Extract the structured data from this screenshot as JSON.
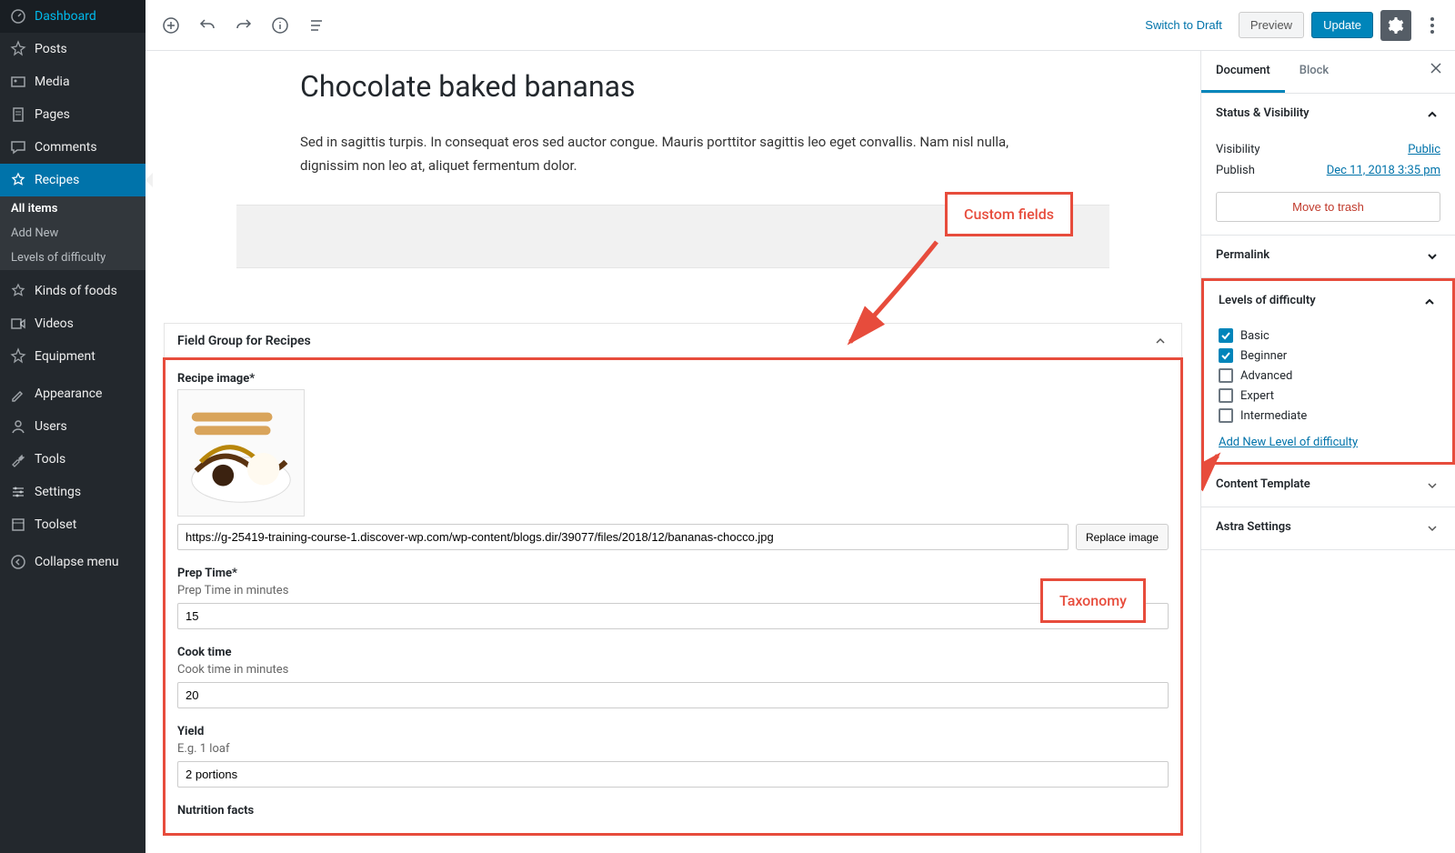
{
  "sidebar": {
    "items": [
      {
        "label": "Dashboard",
        "icon": "dashboard"
      },
      {
        "label": "Posts",
        "icon": "pin"
      },
      {
        "label": "Media",
        "icon": "media"
      },
      {
        "label": "Pages",
        "icon": "page"
      },
      {
        "label": "Comments",
        "icon": "comment"
      },
      {
        "label": "Recipes",
        "icon": "star",
        "active": true,
        "sub": [
          {
            "label": "All items",
            "current": true
          },
          {
            "label": "Add New"
          },
          {
            "label": "Levels of difficulty"
          }
        ]
      },
      {
        "label": "Kinds of foods",
        "icon": "star"
      },
      {
        "label": "Videos",
        "icon": "video"
      },
      {
        "label": "Equipment",
        "icon": "pin"
      },
      {
        "label": "Appearance",
        "icon": "brush"
      },
      {
        "label": "Users",
        "icon": "user"
      },
      {
        "label": "Tools",
        "icon": "wrench"
      },
      {
        "label": "Settings",
        "icon": "sliders"
      },
      {
        "label": "Toolset",
        "icon": "toolset"
      },
      {
        "label": "Collapse menu",
        "icon": "collapse"
      }
    ]
  },
  "topbar": {
    "switch_draft": "Switch to Draft",
    "preview": "Preview",
    "update": "Update"
  },
  "post": {
    "title": "Chocolate baked bananas",
    "body": "Sed in sagittis turpis. In consequat eros sed auctor congue. Mauris porttitor sagittis leo eget convallis. Nam nisl nulla, dignissim non leo at, aliquet fermentum dolor."
  },
  "metabox": {
    "title": "Field Group for Recipes",
    "fields": {
      "image_label": "Recipe image*",
      "image_url": "https://g-25419-training-course-1.discover-wp.com/wp-content/blogs.dir/39077/files/2018/12/bananas-chocco.jpg",
      "replace_image": "Replace image",
      "prep_label": "Prep Time*",
      "prep_desc": "Prep Time in minutes",
      "prep_value": "15",
      "cook_label": "Cook time",
      "cook_desc": "Cook time in minutes",
      "cook_value": "20",
      "yield_label": "Yield",
      "yield_desc": "E.g. 1 loaf",
      "yield_value": "2 portions",
      "nutrition_label": "Nutrition facts"
    }
  },
  "settings": {
    "tabs": {
      "document": "Document",
      "block": "Block"
    },
    "status": {
      "title": "Status & Visibility",
      "visibility_label": "Visibility",
      "visibility_value": "Public",
      "publish_label": "Publish",
      "publish_value": "Dec 11, 2018 3:35 pm",
      "trash": "Move to trash"
    },
    "permalink": {
      "title": "Permalink"
    },
    "levels": {
      "title": "Levels of difficulty",
      "options": [
        {
          "label": "Basic",
          "checked": true
        },
        {
          "label": "Beginner",
          "checked": true
        },
        {
          "label": "Advanced",
          "checked": false
        },
        {
          "label": "Expert",
          "checked": false
        },
        {
          "label": "Intermediate",
          "checked": false
        }
      ],
      "add_new": "Add New Level of difficulty"
    },
    "content_template": {
      "title": "Content Template"
    },
    "astra": {
      "title": "Astra Settings"
    }
  },
  "callouts": {
    "custom_fields": "Custom fields",
    "taxonomy": "Taxonomy"
  }
}
